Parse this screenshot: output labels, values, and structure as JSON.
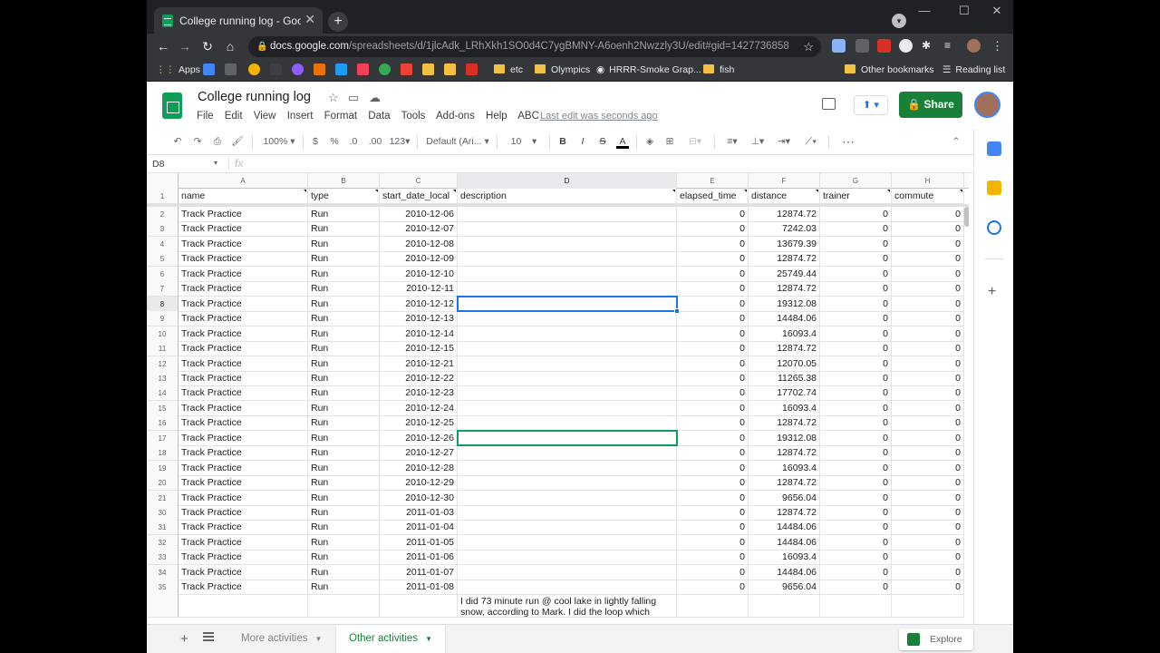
{
  "browser": {
    "tab_title": "College running log - Google Sh",
    "tab_close": "✕",
    "new_tab": "+",
    "url_host": "docs.google.com",
    "url_path": "/spreadsheets/d/1jlcAdk_LRhXkh1SO0d4C7ygBMNY-A6oenh2Nwzzly3U/edit#gid=1427736858",
    "window_controls": [
      "—",
      "☐",
      "✕"
    ],
    "bookmarks": [
      {
        "label": "Apps",
        "icon": "apps-grid-icon"
      },
      {
        "label": "etc",
        "icon": "folder-icon"
      },
      {
        "label": "Olympics",
        "icon": "folder-icon"
      },
      {
        "label": "HRRR-Smoke Grap...",
        "icon": "globe-icon"
      },
      {
        "label": "fish",
        "icon": "folder-icon"
      },
      {
        "label": "Other bookmarks",
        "icon": "folder-icon"
      },
      {
        "label": "Reading list",
        "icon": "reading-list-icon"
      }
    ]
  },
  "doc": {
    "title": "College running log",
    "menus": [
      "File",
      "Edit",
      "View",
      "Insert",
      "Format",
      "Data",
      "Tools",
      "Add-ons",
      "Help",
      "ABC"
    ],
    "last_edit": "Last edit was seconds ago",
    "share_label": "Share"
  },
  "toolbar": {
    "zoom": "100%",
    "currency": "$",
    "percent": "%",
    "dec_dec": ".0",
    "dec_inc": ".00",
    "more_formats": "123",
    "font": "Default (Ari...",
    "font_size": "10",
    "bold": "B",
    "italic": "I",
    "strike": "S",
    "text_color": "A",
    "more": "⋯"
  },
  "formula_bar": {
    "name_box": "D8",
    "fx": "fx",
    "value": ""
  },
  "grid": {
    "column_letters": [
      "A",
      "B",
      "C",
      "D",
      "E",
      "F",
      "G",
      "H"
    ],
    "headers": [
      "name",
      "type",
      "start_date_local",
      "description",
      "elapsed_time",
      "distance",
      "trainer",
      "commute"
    ],
    "rows": [
      {
        "n": "2",
        "name": "Track Practice",
        "type": "Run",
        "date": "2010-12-06",
        "elapsed": "0",
        "distance": "12874.72",
        "trainer": "0",
        "commute": "0"
      },
      {
        "n": "3",
        "name": "Track Practice",
        "type": "Run",
        "date": "2010-12-07",
        "elapsed": "0",
        "distance": "7242.03",
        "trainer": "0",
        "commute": "0"
      },
      {
        "n": "4",
        "name": "Track Practice",
        "type": "Run",
        "date": "2010-12-08",
        "elapsed": "0",
        "distance": "13679.39",
        "trainer": "0",
        "commute": "0"
      },
      {
        "n": "5",
        "name": "Track Practice",
        "type": "Run",
        "date": "2010-12-09",
        "elapsed": "0",
        "distance": "12874.72",
        "trainer": "0",
        "commute": "0"
      },
      {
        "n": "6",
        "name": "Track Practice",
        "type": "Run",
        "date": "2010-12-10",
        "elapsed": "0",
        "distance": "25749.44",
        "trainer": "0",
        "commute": "0"
      },
      {
        "n": "7",
        "name": "Track Practice",
        "type": "Run",
        "date": "2010-12-11",
        "elapsed": "0",
        "distance": "12874.72",
        "trainer": "0",
        "commute": "0"
      },
      {
        "n": "8",
        "name": "Track Practice",
        "type": "Run",
        "date": "2010-12-12",
        "elapsed": "0",
        "distance": "19312.08",
        "trainer": "0",
        "commute": "0"
      },
      {
        "n": "9",
        "name": "Track Practice",
        "type": "Run",
        "date": "2010-12-13",
        "elapsed": "0",
        "distance": "14484.06",
        "trainer": "0",
        "commute": "0"
      },
      {
        "n": "10",
        "name": "Track Practice",
        "type": "Run",
        "date": "2010-12-14",
        "elapsed": "0",
        "distance": "16093.4",
        "trainer": "0",
        "commute": "0"
      },
      {
        "n": "11",
        "name": "Track Practice",
        "type": "Run",
        "date": "2010-12-15",
        "elapsed": "0",
        "distance": "12874.72",
        "trainer": "0",
        "commute": "0"
      },
      {
        "n": "12",
        "name": "Track Practice",
        "type": "Run",
        "date": "2010-12-21",
        "elapsed": "0",
        "distance": "12070.05",
        "trainer": "0",
        "commute": "0"
      },
      {
        "n": "13",
        "name": "Track Practice",
        "type": "Run",
        "date": "2010-12-22",
        "elapsed": "0",
        "distance": "11265.38",
        "trainer": "0",
        "commute": "0"
      },
      {
        "n": "14",
        "name": "Track Practice",
        "type": "Run",
        "date": "2010-12-23",
        "elapsed": "0",
        "distance": "17702.74",
        "trainer": "0",
        "commute": "0"
      },
      {
        "n": "15",
        "name": "Track Practice",
        "type": "Run",
        "date": "2010-12-24",
        "elapsed": "0",
        "distance": "16093.4",
        "trainer": "0",
        "commute": "0"
      },
      {
        "n": "16",
        "name": "Track Practice",
        "type": "Run",
        "date": "2010-12-25",
        "elapsed": "0",
        "distance": "12874.72",
        "trainer": "0",
        "commute": "0"
      },
      {
        "n": "17",
        "name": "Track Practice",
        "type": "Run",
        "date": "2010-12-26",
        "elapsed": "0",
        "distance": "19312.08",
        "trainer": "0",
        "commute": "0"
      },
      {
        "n": "18",
        "name": "Track Practice",
        "type": "Run",
        "date": "2010-12-27",
        "elapsed": "0",
        "distance": "12874.72",
        "trainer": "0",
        "commute": "0"
      },
      {
        "n": "19",
        "name": "Track Practice",
        "type": "Run",
        "date": "2010-12-28",
        "elapsed": "0",
        "distance": "16093.4",
        "trainer": "0",
        "commute": "0"
      },
      {
        "n": "20",
        "name": "Track Practice",
        "type": "Run",
        "date": "2010-12-29",
        "elapsed": "0",
        "distance": "12874.72",
        "trainer": "0",
        "commute": "0"
      },
      {
        "n": "21",
        "name": "Track Practice",
        "type": "Run",
        "date": "2010-12-30",
        "elapsed": "0",
        "distance": "9656.04",
        "trainer": "0",
        "commute": "0"
      },
      {
        "n": "30",
        "name": "Track Practice",
        "type": "Run",
        "date": "2011-01-03",
        "elapsed": "0",
        "distance": "12874.72",
        "trainer": "0",
        "commute": "0"
      },
      {
        "n": "31",
        "name": "Track Practice",
        "type": "Run",
        "date": "2011-01-04",
        "elapsed": "0",
        "distance": "14484.06",
        "trainer": "0",
        "commute": "0"
      },
      {
        "n": "32",
        "name": "Track Practice",
        "type": "Run",
        "date": "2011-01-05",
        "elapsed": "0",
        "distance": "14484.06",
        "trainer": "0",
        "commute": "0"
      },
      {
        "n": "33",
        "name": "Track Practice",
        "type": "Run",
        "date": "2011-01-06",
        "elapsed": "0",
        "distance": "16093.4",
        "trainer": "0",
        "commute": "0"
      },
      {
        "n": "34",
        "name": "Track Practice",
        "type": "Run",
        "date": "2011-01-07",
        "elapsed": "0",
        "distance": "14484.06",
        "trainer": "0",
        "commute": "0"
      },
      {
        "n": "35",
        "name": "Track Practice",
        "type": "Run",
        "date": "2011-01-08",
        "elapsed": "0",
        "distance": "9656.04",
        "trainer": "0",
        "commute": "0"
      }
    ],
    "next_row_description": "I did 73 minute run @ cool lake in lightly falling snow, according to Mark. I did the loop which"
  },
  "sheets": {
    "add": "+",
    "tabs": [
      {
        "label": "More activities",
        "active": false
      },
      {
        "label": "Other activities",
        "active": true
      }
    ],
    "explore_label": "Explore"
  },
  "colors": {
    "sheets_green": "#0f9d58",
    "share_green": "#188038",
    "selection_blue": "#1a73e8"
  }
}
